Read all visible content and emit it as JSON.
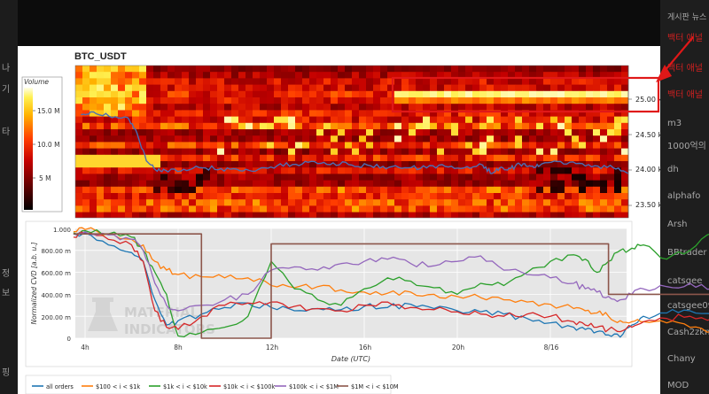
{
  "heatmap": {
    "title": "BTC_USDT",
    "colorbar_label": "Volume",
    "colorbar_ticks": [
      "15.0 M",
      "10.0 M",
      "5 M"
    ],
    "y_ticks": [
      "25.00 k",
      "24.50 k",
      "24.00 k",
      "23.50 k"
    ]
  },
  "cvd": {
    "ylabel": "Normalized CVD [a.b. u.]",
    "xlabel": "Date (UTC)",
    "y_ticks": [
      "1.000",
      "800.00 m",
      "600.00 m",
      "400.00 m",
      "200.00 m",
      "0"
    ],
    "x_ticks": [
      "4h",
      "8h",
      "12h",
      "16h",
      "20h",
      "8/16"
    ],
    "watermark_line1": "MATERIAL",
    "watermark_line2": "INDICATORS"
  },
  "legend": [
    "all orders",
    "$100 < i < $1k",
    "$1k < i < $10k",
    "$10k < i < $100k",
    "$100k < i < $1M",
    "$1M < i < $10M"
  ],
  "side": {
    "top_text": "게시판 뉴스 > 3",
    "items": [
      "백터 애널",
      "백터 애널",
      "백터 애널",
      "m3",
      "1000억의",
      "dh",
      "alphafo",
      "Arsh",
      "BBtrader",
      "catsgee",
      "catsgee09",
      "Cash2zkn",
      "Chany",
      "MOD"
    ]
  },
  "left_glyphs": [
    "나",
    "기",
    "타",
    "정",
    "보",
    "핑"
  ],
  "chart_data": [
    {
      "type": "heatmap",
      "title": "BTC_USDT",
      "y_ticks": [
        25000,
        24500,
        24000,
        23500
      ],
      "ylim": [
        23350,
        25250
      ],
      "colorbar": {
        "label": "Volume",
        "range": [
          0,
          18000000
        ],
        "ticks": [
          15000000,
          10000000,
          5000000
        ]
      },
      "overlay_series": {
        "name": "price",
        "color": "#4a6fb5",
        "x": [
          3.5,
          4,
          5,
          6,
          6.5,
          7,
          7.5,
          8,
          9,
          10,
          11,
          12,
          13,
          14,
          15,
          16,
          17,
          18,
          19,
          20,
          21,
          22,
          23,
          24,
          25,
          25.5,
          26,
          26.5,
          27,
          27.5,
          28,
          29,
          30,
          31,
          32,
          32.8
        ],
        "y": [
          24780,
          24820,
          24760,
          24740,
          24520,
          24130,
          24000,
          24000,
          24010,
          24030,
          24020,
          23990,
          24010,
          24060,
          24080,
          24120,
          24100,
          24070,
          24060,
          24040,
          24030,
          24030,
          24050,
          24030,
          24070,
          23950,
          24040,
          24020,
          24080,
          24060,
          24050,
          24120,
          24090,
          24060,
          24030,
          23950
        ]
      },
      "highlight_band_y": [
        24900,
        25150
      ]
    },
    {
      "type": "line",
      "xlabel": "Date (UTC)",
      "ylabel": "Normalized CVD [a.b. u.]",
      "x_ticks": [
        "4h",
        "8h",
        "12h",
        "16h",
        "20h",
        "8/16"
      ],
      "ylim": [
        0,
        1
      ],
      "x": [
        3.5,
        4,
        5,
        6,
        6.5,
        7,
        7.5,
        8,
        9,
        10,
        11,
        12,
        13,
        14,
        15,
        16,
        17,
        18,
        19,
        20,
        21,
        22,
        23,
        24,
        25,
        25.5,
        26,
        26.5,
        27,
        27.5,
        28,
        29,
        30,
        31,
        32,
        32.8
      ],
      "series": [
        {
          "name": "all orders",
          "color": "#1f77b4",
          "values": [
            0.95,
            0.96,
            0.85,
            0.78,
            0.7,
            0.35,
            0.12,
            0.16,
            0.22,
            0.28,
            0.32,
            0.28,
            0.25,
            0.27,
            0.26,
            0.29,
            0.28,
            0.31,
            0.27,
            0.25,
            0.24,
            0.22,
            0.18,
            0.14,
            0.1,
            0.08,
            0.06,
            0.03,
            0.01,
            0.12,
            0.2,
            0.23,
            0.25,
            0.22,
            0.18,
            0.08
          ]
        },
        {
          "name": "$100 < i < $1k",
          "color": "#ff7f0e",
          "values": [
            0.97,
            0.99,
            0.95,
            0.9,
            0.85,
            0.7,
            0.62,
            0.58,
            0.56,
            0.55,
            0.55,
            0.48,
            0.46,
            0.47,
            0.44,
            0.42,
            0.41,
            0.42,
            0.4,
            0.38,
            0.37,
            0.35,
            0.33,
            0.31,
            0.27,
            0.25,
            0.23,
            0.2,
            0.16,
            0.15,
            0.15,
            0.14,
            0.1,
            0.07,
            0.03,
            0.02
          ]
        },
        {
          "name": "$1k < i < $10k",
          "color": "#2ca02c",
          "values": [
            0.96,
            0.98,
            0.95,
            0.92,
            0.8,
            0.6,
            0.4,
            0.02,
            0.05,
            0.1,
            0.2,
            0.7,
            0.45,
            0.35,
            0.3,
            0.45,
            0.55,
            0.52,
            0.46,
            0.4,
            0.5,
            0.48,
            0.6,
            0.7,
            0.76,
            0.72,
            0.6,
            0.7,
            0.8,
            0.82,
            0.85,
            0.72,
            0.8,
            0.96,
            0.94,
            0.56
          ]
        },
        {
          "name": "$10k < i < $100k",
          "color": "#d62728",
          "values": [
            0.92,
            0.95,
            0.9,
            0.85,
            0.7,
            0.25,
            0.1,
            0.08,
            0.2,
            0.3,
            0.32,
            0.33,
            0.29,
            0.27,
            0.25,
            0.3,
            0.33,
            0.28,
            0.26,
            0.24,
            0.22,
            0.2,
            0.22,
            0.2,
            0.15,
            0.12,
            0.1,
            0.08,
            0.06,
            0.1,
            0.15,
            0.18,
            0.2,
            0.18,
            0.15,
            0.08
          ]
        },
        {
          "name": "$100k < i < $1M",
          "color": "#9467bd",
          "values": [
            0.95,
            0.97,
            0.94,
            0.9,
            0.8,
            0.5,
            0.3,
            0.25,
            0.3,
            0.35,
            0.4,
            0.62,
            0.65,
            0.62,
            0.68,
            0.7,
            0.72,
            0.68,
            0.66,
            0.7,
            0.75,
            0.62,
            0.58,
            0.55,
            0.5,
            0.45,
            0.42,
            0.38,
            0.35,
            0.4,
            0.45,
            0.47,
            0.5,
            0.45,
            0.48,
            0.35
          ]
        },
        {
          "name": "$1M < i < $10M",
          "color": "#8c564b",
          "values": [
            0.95,
            0.95,
            0.95,
            0.95,
            0.95,
            0.95,
            0.95,
            0.95,
            0.0,
            0.0,
            0.0,
            0.86,
            0.86,
            0.86,
            0.86,
            0.86,
            0.86,
            0.86,
            0.86,
            0.86,
            0.86,
            0.86,
            0.86,
            0.86,
            0.86,
            0.86,
            0.86,
            0.4,
            0.4,
            0.4,
            0.4,
            0.4,
            0.4,
            0.4,
            0.4,
            0.4
          ]
        }
      ]
    }
  ]
}
